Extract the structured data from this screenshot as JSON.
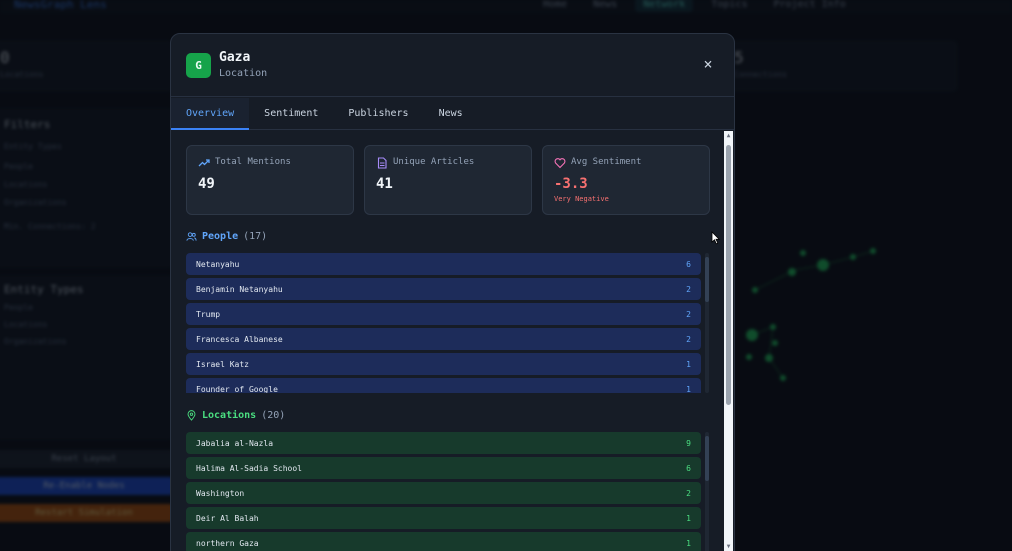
{
  "background": {
    "brand": "NewsGraph Lens",
    "nav": [
      "Home",
      "News",
      "Network",
      "Topics",
      "Project Info"
    ],
    "left_stat": {
      "value": "0",
      "label": "Locations"
    },
    "right_stat": {
      "value": "5",
      "label": "Connections"
    },
    "filters_title": "Filters",
    "filter_items": [
      "Entity Types",
      "People",
      "Locations",
      "Organizations",
      "Min. Connections: 2"
    ],
    "entity_types_title": "Entity Types",
    "entity_type_items": [
      "People",
      "Locations",
      "Organizations"
    ],
    "buttons": [
      "Reset Layout",
      "Re-Enable Nodes",
      "Restart Simulation"
    ]
  },
  "modal": {
    "badge": "G",
    "title": "Gaza",
    "subtitle": "Location",
    "close": "×",
    "tabs": [
      {
        "label": "Overview",
        "active": true
      },
      {
        "label": "Sentiment",
        "active": false
      },
      {
        "label": "Publishers",
        "active": false
      },
      {
        "label": "News",
        "active": false
      }
    ],
    "cards": [
      {
        "label": "Total Mentions",
        "value": "49",
        "icon": "trending-up-icon"
      },
      {
        "label": "Unique Articles",
        "value": "41",
        "icon": "document-icon"
      },
      {
        "label": "Avg Sentiment",
        "value": "-3.3",
        "note": "Very Negative",
        "icon": "heart-icon"
      }
    ],
    "people": {
      "title": "People",
      "count": "(17)",
      "items": [
        {
          "name": "Netanyahu",
          "count": "6"
        },
        {
          "name": "Benjamin Netanyahu",
          "count": "2"
        },
        {
          "name": "Trump",
          "count": "2"
        },
        {
          "name": "Francesca Albanese",
          "count": "2"
        },
        {
          "name": "Israel Katz",
          "count": "1"
        },
        {
          "name": "Founder of Google",
          "count": "1"
        }
      ]
    },
    "locations": {
      "title": "Locations",
      "count": "(20)",
      "items": [
        {
          "name": "Jabalia al-Nazla",
          "count": "9"
        },
        {
          "name": "Halima Al-Sadia School",
          "count": "6"
        },
        {
          "name": "Washington",
          "count": "2"
        },
        {
          "name": "Deir Al Balah",
          "count": "1"
        },
        {
          "name": "northern Gaza",
          "count": "1"
        }
      ]
    }
  },
  "colors": {
    "accent_blue": "#3b82f6",
    "people_row": "#1d2c5a",
    "location_row": "#173a2c",
    "negative": "#f87171",
    "badge_green": "#16a34a"
  }
}
